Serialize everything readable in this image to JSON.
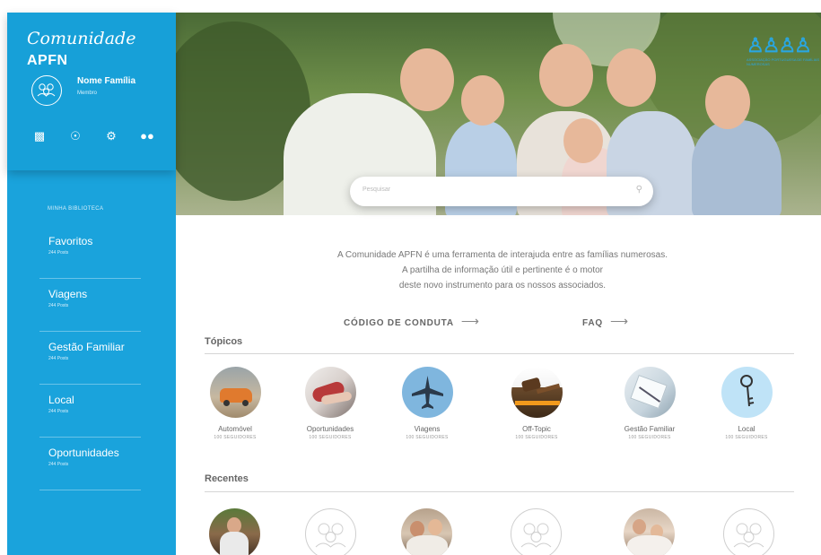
{
  "sidebar": {
    "brand_script": "Comunidade",
    "brand_caps": "APFN",
    "user": {
      "name": "Nome Família",
      "role": "Membro"
    },
    "icons": [
      "chat-icon",
      "globe-icon",
      "gear-icon",
      "group-icon"
    ],
    "library_label": "MINHA BIBLIOTECA",
    "items": [
      {
        "label": "Favoritos",
        "posts": "244 Posts"
      },
      {
        "label": "Viagens",
        "posts": "244 Posts"
      },
      {
        "label": "Gestão Familiar",
        "posts": "244 Posts"
      },
      {
        "label": "Local",
        "posts": "244 Posts"
      },
      {
        "label": "Oportunidades",
        "posts": "244 Posts"
      }
    ]
  },
  "hero": {
    "search_placeholder": "Pesquisar",
    "logo_caption": "ASSOCIAÇÃO PORTUGUESA DE FAMÍLIAS NUMEROSAS"
  },
  "intro": {
    "lines": [
      "A Comunidade APFN é uma ferramenta de interajuda entre as famílias numerosas.",
      "A partilha de informação útil e pertinente é o motor",
      "deste novo instrumento para os nossos associados."
    ]
  },
  "links": {
    "conduct": "CÓDIGO DE CONDUTA",
    "faq": "FAQ"
  },
  "topics": {
    "title": "Tópicos",
    "items": [
      {
        "name": "Automóvel",
        "followers": "100 SEGUIDORES"
      },
      {
        "name": "Oportunidades",
        "followers": "100 SEGUIDORES"
      },
      {
        "name": "Viagens",
        "followers": "100 SEGUIDORES"
      },
      {
        "name": "Off-Topic",
        "followers": "100 SEGUIDORES"
      },
      {
        "name": "Gestão Familiar",
        "followers": "100 SEGUIDORES"
      },
      {
        "name": "Local",
        "followers": "100 SEGUIDORES"
      }
    ]
  },
  "recents": {
    "title": "Recentes"
  },
  "colors": {
    "accent": "#1aa3dc",
    "text": "#666666"
  }
}
